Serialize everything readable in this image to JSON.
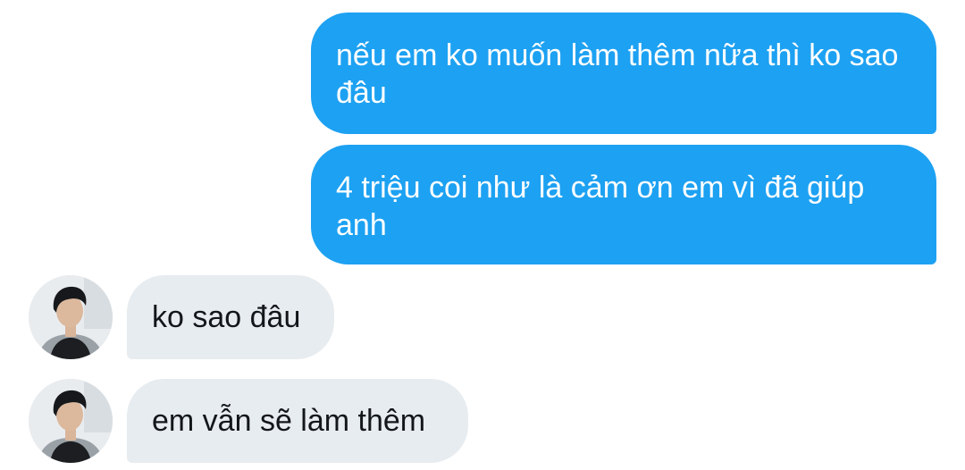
{
  "messages": [
    {
      "direction": "outgoing",
      "text": "nếu em ko muốn làm thêm nữa thì ko sao đâu"
    },
    {
      "direction": "outgoing",
      "text": "4 triệu coi như là cảm ơn em vì đã giúp anh"
    },
    {
      "direction": "incoming",
      "text": "ko sao đâu"
    },
    {
      "direction": "incoming",
      "text": "em vẫn sẽ làm thêm"
    }
  ],
  "colors": {
    "outgoing_bubble": "#1da1f2",
    "incoming_bubble": "#e7ecf0",
    "outgoing_text": "#ffffff",
    "incoming_text": "#14171a"
  },
  "icons": {
    "contact_avatar": "contact-avatar-photo"
  }
}
